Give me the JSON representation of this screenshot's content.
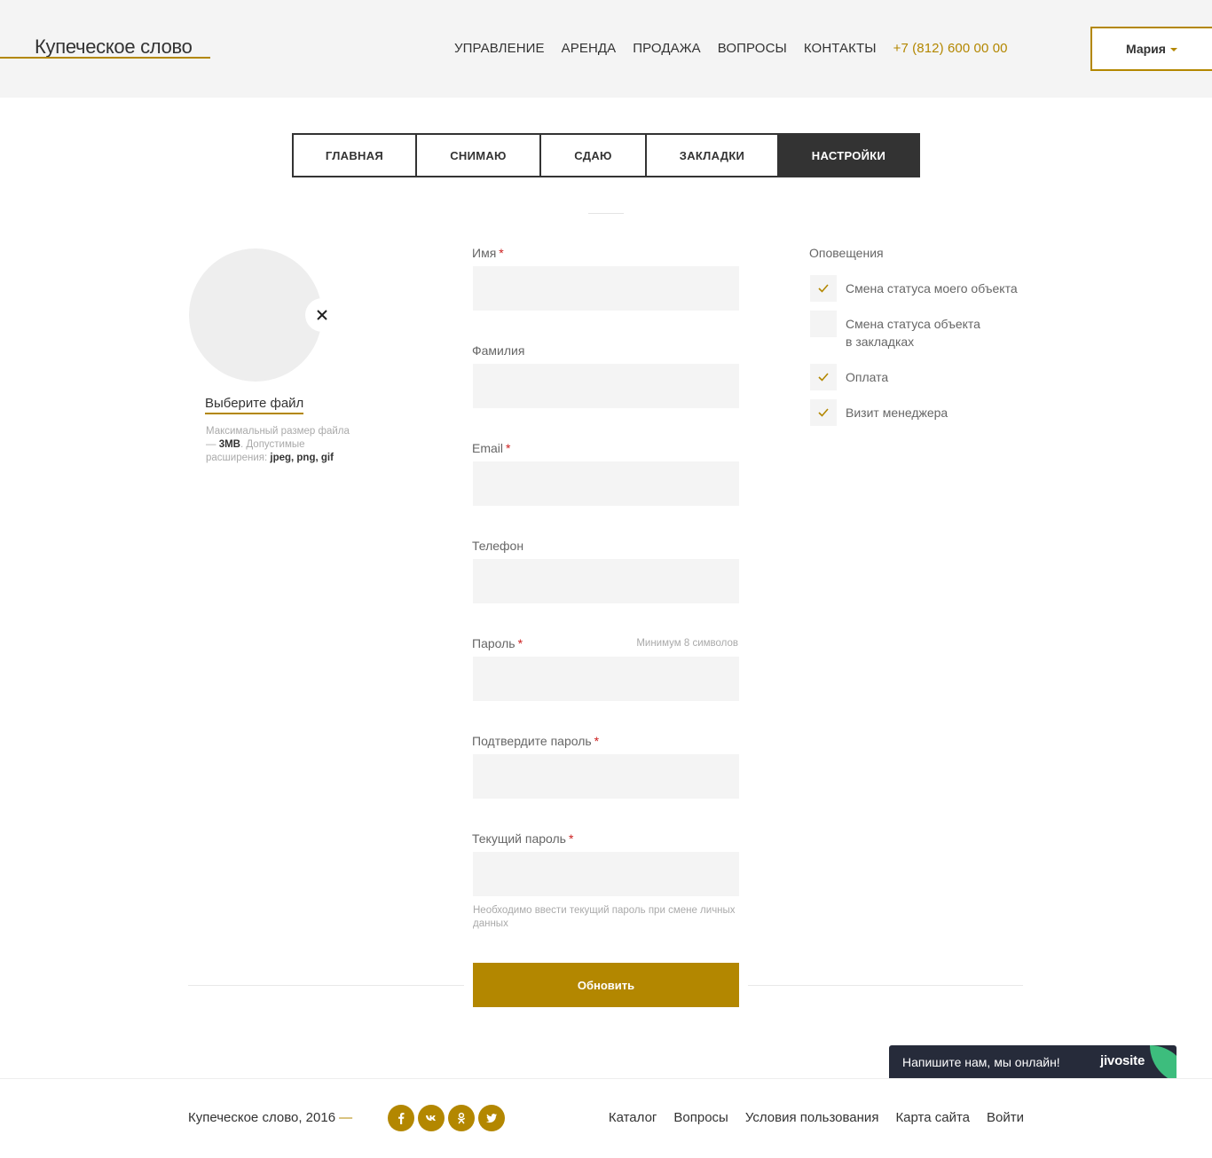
{
  "header": {
    "logo": "Купеческое слово",
    "nav": [
      "УПРАВЛЕНИЕ",
      "АРЕНДА",
      "ПРОДАЖА",
      "ВОПРОСЫ",
      "КОНТАКТЫ"
    ],
    "phone": "+7 (812) 600 00 00",
    "user": "Мария"
  },
  "tabs": [
    {
      "label": "ГЛАВНАЯ"
    },
    {
      "label": "СНИМАЮ"
    },
    {
      "label": "СДАЮ"
    },
    {
      "label": "ЗАКЛАДКИ"
    },
    {
      "label": "НАСТРОЙКИ",
      "active": true
    }
  ],
  "avatar": {
    "choose_file": "Выберите файл",
    "hint_1": "Максимальный размер файла — ",
    "hint_size": "3MB",
    "hint_2": ". Допустимые расширения: ",
    "hint_ext": "jpeg, png, gif"
  },
  "form": {
    "first_name": {
      "label": "Имя",
      "required": "*",
      "value": ""
    },
    "last_name": {
      "label": "Фамилия",
      "value": ""
    },
    "email": {
      "label": "Email",
      "required": "*",
      "value": ""
    },
    "phone": {
      "label": "Телефон",
      "value": ""
    },
    "password": {
      "label": "Пароль",
      "required": "*",
      "hint": "Минимум 8 символов",
      "value": ""
    },
    "confirm_password": {
      "label": "Подтвердите пароль",
      "required": "*",
      "value": ""
    },
    "current_password": {
      "label": "Текущий пароль",
      "required": "*",
      "value": ""
    },
    "current_password_note": "Необходимо ввести текущий пароль при смене личных данных",
    "submit": "Обновить"
  },
  "notifications": {
    "title": "Оповещения",
    "items": [
      {
        "label": "Смена статуса моего объекта",
        "checked": true
      },
      {
        "label": "Смена статуса объекта в закладках",
        "checked": false
      },
      {
        "label": "Оплата",
        "checked": true
      },
      {
        "label": "Визит менеджера",
        "checked": true
      }
    ]
  },
  "footer": {
    "copyright": "Купеческое слово, 2016",
    "dash": "—",
    "social": [
      "facebook-icon",
      "vk-icon",
      "odnoklassniki-icon",
      "twitter-icon"
    ],
    "links": [
      "Каталог",
      "Вопросы",
      "Условия пользования",
      "Карта сайта",
      "Войти"
    ]
  },
  "chat": {
    "text": "Напишите нам, мы онлайн!",
    "brand": "jivosite"
  },
  "colors": {
    "accent": "#b38700",
    "dark": "#333333",
    "input_bg": "#f4f4f4",
    "required": "#cc1f1f",
    "chat_bg": "#262b3a",
    "chat_leaf": "#3dbd7d"
  }
}
